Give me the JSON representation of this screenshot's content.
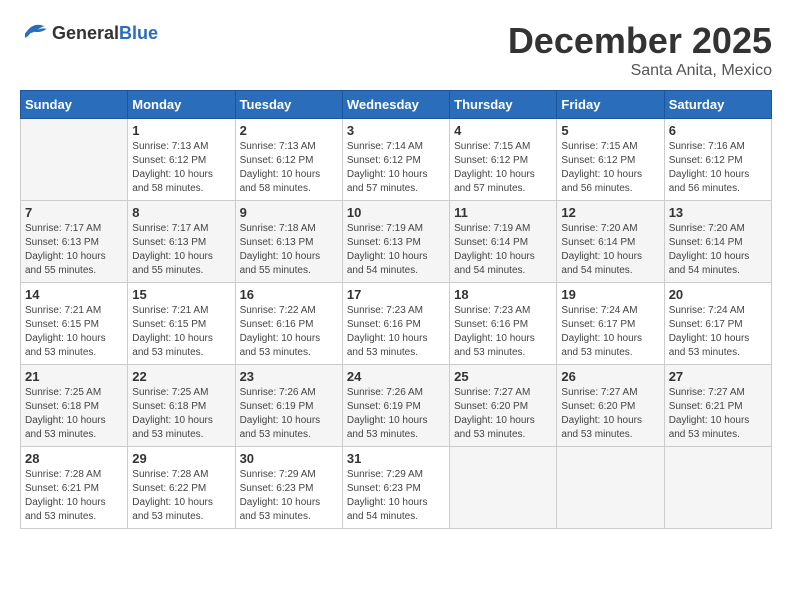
{
  "logo": {
    "general": "General",
    "blue": "Blue"
  },
  "title": {
    "month": "December 2025",
    "location": "Santa Anita, Mexico"
  },
  "days_of_week": [
    "Sunday",
    "Monday",
    "Tuesday",
    "Wednesday",
    "Thursday",
    "Friday",
    "Saturday"
  ],
  "weeks": [
    [
      {
        "day": "",
        "sunrise": "",
        "sunset": "",
        "daylight": ""
      },
      {
        "day": "1",
        "sunrise": "Sunrise: 7:13 AM",
        "sunset": "Sunset: 6:12 PM",
        "daylight": "Daylight: 10 hours and 58 minutes."
      },
      {
        "day": "2",
        "sunrise": "Sunrise: 7:13 AM",
        "sunset": "Sunset: 6:12 PM",
        "daylight": "Daylight: 10 hours and 58 minutes."
      },
      {
        "day": "3",
        "sunrise": "Sunrise: 7:14 AM",
        "sunset": "Sunset: 6:12 PM",
        "daylight": "Daylight: 10 hours and 57 minutes."
      },
      {
        "day": "4",
        "sunrise": "Sunrise: 7:15 AM",
        "sunset": "Sunset: 6:12 PM",
        "daylight": "Daylight: 10 hours and 57 minutes."
      },
      {
        "day": "5",
        "sunrise": "Sunrise: 7:15 AM",
        "sunset": "Sunset: 6:12 PM",
        "daylight": "Daylight: 10 hours and 56 minutes."
      },
      {
        "day": "6",
        "sunrise": "Sunrise: 7:16 AM",
        "sunset": "Sunset: 6:12 PM",
        "daylight": "Daylight: 10 hours and 56 minutes."
      }
    ],
    [
      {
        "day": "7",
        "sunrise": "Sunrise: 7:17 AM",
        "sunset": "Sunset: 6:13 PM",
        "daylight": "Daylight: 10 hours and 55 minutes."
      },
      {
        "day": "8",
        "sunrise": "Sunrise: 7:17 AM",
        "sunset": "Sunset: 6:13 PM",
        "daylight": "Daylight: 10 hours and 55 minutes."
      },
      {
        "day": "9",
        "sunrise": "Sunrise: 7:18 AM",
        "sunset": "Sunset: 6:13 PM",
        "daylight": "Daylight: 10 hours and 55 minutes."
      },
      {
        "day": "10",
        "sunrise": "Sunrise: 7:19 AM",
        "sunset": "Sunset: 6:13 PM",
        "daylight": "Daylight: 10 hours and 54 minutes."
      },
      {
        "day": "11",
        "sunrise": "Sunrise: 7:19 AM",
        "sunset": "Sunset: 6:14 PM",
        "daylight": "Daylight: 10 hours and 54 minutes."
      },
      {
        "day": "12",
        "sunrise": "Sunrise: 7:20 AM",
        "sunset": "Sunset: 6:14 PM",
        "daylight": "Daylight: 10 hours and 54 minutes."
      },
      {
        "day": "13",
        "sunrise": "Sunrise: 7:20 AM",
        "sunset": "Sunset: 6:14 PM",
        "daylight": "Daylight: 10 hours and 54 minutes."
      }
    ],
    [
      {
        "day": "14",
        "sunrise": "Sunrise: 7:21 AM",
        "sunset": "Sunset: 6:15 PM",
        "daylight": "Daylight: 10 hours and 53 minutes."
      },
      {
        "day": "15",
        "sunrise": "Sunrise: 7:21 AM",
        "sunset": "Sunset: 6:15 PM",
        "daylight": "Daylight: 10 hours and 53 minutes."
      },
      {
        "day": "16",
        "sunrise": "Sunrise: 7:22 AM",
        "sunset": "Sunset: 6:16 PM",
        "daylight": "Daylight: 10 hours and 53 minutes."
      },
      {
        "day": "17",
        "sunrise": "Sunrise: 7:23 AM",
        "sunset": "Sunset: 6:16 PM",
        "daylight": "Daylight: 10 hours and 53 minutes."
      },
      {
        "day": "18",
        "sunrise": "Sunrise: 7:23 AM",
        "sunset": "Sunset: 6:16 PM",
        "daylight": "Daylight: 10 hours and 53 minutes."
      },
      {
        "day": "19",
        "sunrise": "Sunrise: 7:24 AM",
        "sunset": "Sunset: 6:17 PM",
        "daylight": "Daylight: 10 hours and 53 minutes."
      },
      {
        "day": "20",
        "sunrise": "Sunrise: 7:24 AM",
        "sunset": "Sunset: 6:17 PM",
        "daylight": "Daylight: 10 hours and 53 minutes."
      }
    ],
    [
      {
        "day": "21",
        "sunrise": "Sunrise: 7:25 AM",
        "sunset": "Sunset: 6:18 PM",
        "daylight": "Daylight: 10 hours and 53 minutes."
      },
      {
        "day": "22",
        "sunrise": "Sunrise: 7:25 AM",
        "sunset": "Sunset: 6:18 PM",
        "daylight": "Daylight: 10 hours and 53 minutes."
      },
      {
        "day": "23",
        "sunrise": "Sunrise: 7:26 AM",
        "sunset": "Sunset: 6:19 PM",
        "daylight": "Daylight: 10 hours and 53 minutes."
      },
      {
        "day": "24",
        "sunrise": "Sunrise: 7:26 AM",
        "sunset": "Sunset: 6:19 PM",
        "daylight": "Daylight: 10 hours and 53 minutes."
      },
      {
        "day": "25",
        "sunrise": "Sunrise: 7:27 AM",
        "sunset": "Sunset: 6:20 PM",
        "daylight": "Daylight: 10 hours and 53 minutes."
      },
      {
        "day": "26",
        "sunrise": "Sunrise: 7:27 AM",
        "sunset": "Sunset: 6:20 PM",
        "daylight": "Daylight: 10 hours and 53 minutes."
      },
      {
        "day": "27",
        "sunrise": "Sunrise: 7:27 AM",
        "sunset": "Sunset: 6:21 PM",
        "daylight": "Daylight: 10 hours and 53 minutes."
      }
    ],
    [
      {
        "day": "28",
        "sunrise": "Sunrise: 7:28 AM",
        "sunset": "Sunset: 6:21 PM",
        "daylight": "Daylight: 10 hours and 53 minutes."
      },
      {
        "day": "29",
        "sunrise": "Sunrise: 7:28 AM",
        "sunset": "Sunset: 6:22 PM",
        "daylight": "Daylight: 10 hours and 53 minutes."
      },
      {
        "day": "30",
        "sunrise": "Sunrise: 7:29 AM",
        "sunset": "Sunset: 6:23 PM",
        "daylight": "Daylight: 10 hours and 53 minutes."
      },
      {
        "day": "31",
        "sunrise": "Sunrise: 7:29 AM",
        "sunset": "Sunset: 6:23 PM",
        "daylight": "Daylight: 10 hours and 54 minutes."
      },
      {
        "day": "",
        "sunrise": "",
        "sunset": "",
        "daylight": ""
      },
      {
        "day": "",
        "sunrise": "",
        "sunset": "",
        "daylight": ""
      },
      {
        "day": "",
        "sunrise": "",
        "sunset": "",
        "daylight": ""
      }
    ]
  ]
}
